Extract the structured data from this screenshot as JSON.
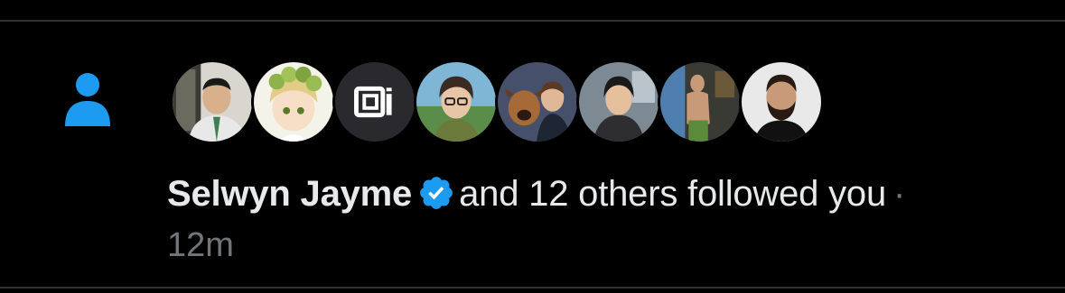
{
  "notification": {
    "type_icon": "person-icon",
    "follower_name": "Selwyn Jayme",
    "verified_icon": "verified-badge-icon",
    "action_text": "and 12 others followed you",
    "separator": "·",
    "timestamp": "12m",
    "avatars": [
      {
        "name": "avatar-1"
      },
      {
        "name": "avatar-2"
      },
      {
        "name": "avatar-3-logo",
        "logo_text": "BTi"
      },
      {
        "name": "avatar-4"
      },
      {
        "name": "avatar-5"
      },
      {
        "name": "avatar-6"
      },
      {
        "name": "avatar-7"
      },
      {
        "name": "avatar-8"
      }
    ]
  },
  "colors": {
    "background": "#000000",
    "accent": "#1d9bf0",
    "text_primary": "#e7e9ea",
    "text_secondary": "#71767b",
    "divider": "#2f3336"
  }
}
